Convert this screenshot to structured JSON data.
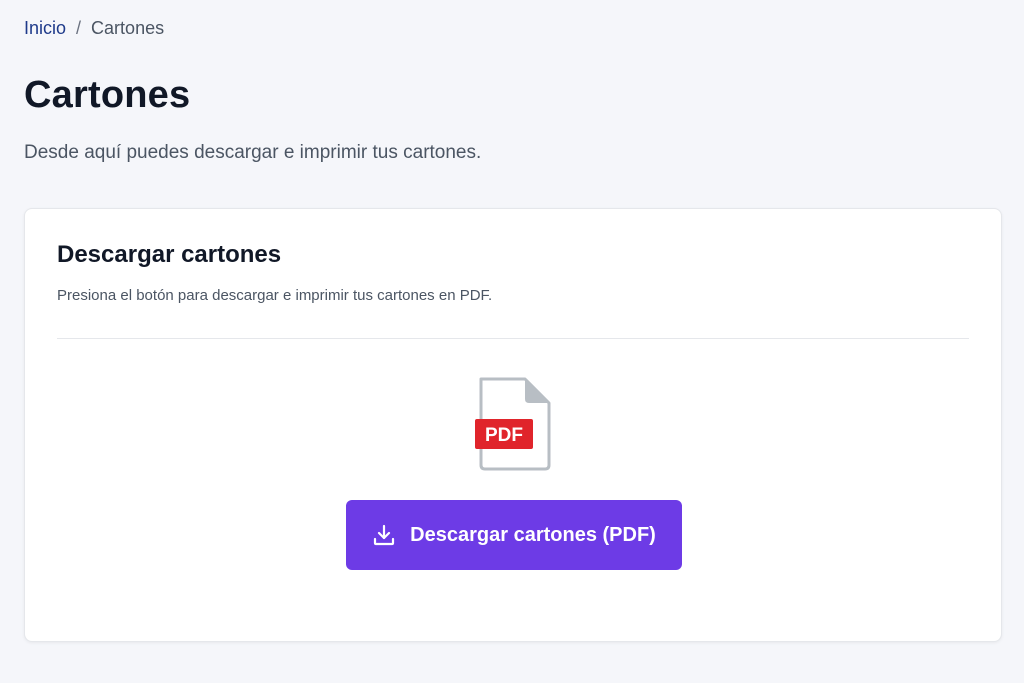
{
  "breadcrumb": {
    "home": "Inicio",
    "separator": "/",
    "current": "Cartones"
  },
  "page": {
    "title": "Cartones",
    "subtitle": "Desde aquí puedes descargar e imprimir tus cartones."
  },
  "card": {
    "title": "Descargar cartones",
    "description": "Presiona el botón para descargar e imprimir tus cartones en PDF.",
    "file_icon": "pdf-file-icon",
    "file_badge": "PDF",
    "button_icon": "download-icon",
    "button_label": "Descargar cartones (PDF)"
  },
  "colors": {
    "accent": "#6d3be6",
    "pdf_badge": "#e0242b",
    "link": "#1e3a8a"
  }
}
